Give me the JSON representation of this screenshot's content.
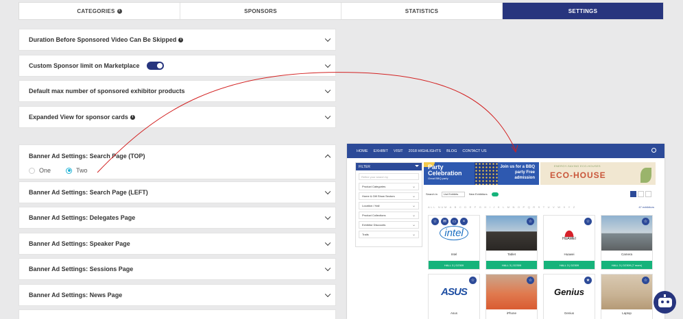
{
  "tabs": [
    {
      "label": "CATEGORIES",
      "info": true
    },
    {
      "label": "SPONSORS"
    },
    {
      "label": "STATISTICS"
    },
    {
      "label": "SETTINGS",
      "active": true
    }
  ],
  "settings": {
    "skip_duration": "Duration Before Sponsored Video Can Be Skipped",
    "custom_limit": "Custom Sponsor limit on Marketplace",
    "custom_limit_enabled": true,
    "default_max": "Default max number of sponsored exhibitor products",
    "expanded_view": "Expanded View for sponsor cards",
    "search_top": "Banner Ad Settings: Search Page (TOP)",
    "option_one": "One",
    "option_two": "Two",
    "selected_option": "Two",
    "search_left": "Banner Ad Settings: Search Page (LEFT)",
    "delegates": "Banner Ad Settings: Delegates Page",
    "speaker": "Banner Ad Settings: Speaker Page",
    "sessions": "Banner Ad Settings: Sessions Page",
    "news": "Banner Ad Settings: News Page"
  },
  "preview": {
    "nav": [
      "HOME",
      "EXHIBIT",
      "VISIT",
      "2018 HIGHLIGHTS",
      "BLOG",
      "CONTACT US"
    ],
    "sidebar": {
      "header": "FILTER",
      "search_placeholder": "Refine your search by",
      "items": [
        "Product Categories",
        "Home & Gift Show Sectors",
        "Location / Hall",
        "Product Collections",
        "Exhibitor Discounts",
        "Trails"
      ]
    },
    "banner1": {
      "title": "Party Celebration",
      "sub": "Great BBQ party",
      "cta": "Join us for a BBQ party Free admission"
    },
    "banner2": {
      "top": "ENERGY-SAVING ECO-HOUSES",
      "main": "ECO-HOUSE"
    },
    "filter": {
      "search_in": "Search in",
      "select": "List Exhibits",
      "new": "New Exhibitors"
    },
    "alphabet": "ALL NUM A B C D E F G H I J K L M N O P Q R S T U V W X Y Z",
    "count": "47 exhibitors",
    "cards": [
      {
        "name": "Intel",
        "footer": "HALL 3 | D2309"
      },
      {
        "name": "Tablet",
        "footer": "HALL 3 | D2309"
      },
      {
        "name": "Huawei",
        "footer": "HALL 3 | D2309",
        "logo": "HUAWEI"
      },
      {
        "name": "Camera",
        "footer": "HALL 3 | D2309 (7 more)"
      },
      {
        "name": "Asus",
        "logo": "ASUS"
      },
      {
        "name": "iPhone"
      },
      {
        "name": "Genius",
        "logo": "Genius"
      },
      {
        "name": "Laptop"
      }
    ]
  },
  "colors": {
    "accent": "#27357e",
    "preview_nav": "#2c4a98",
    "green": "#16b37b",
    "arrow": "#d21f1f"
  }
}
